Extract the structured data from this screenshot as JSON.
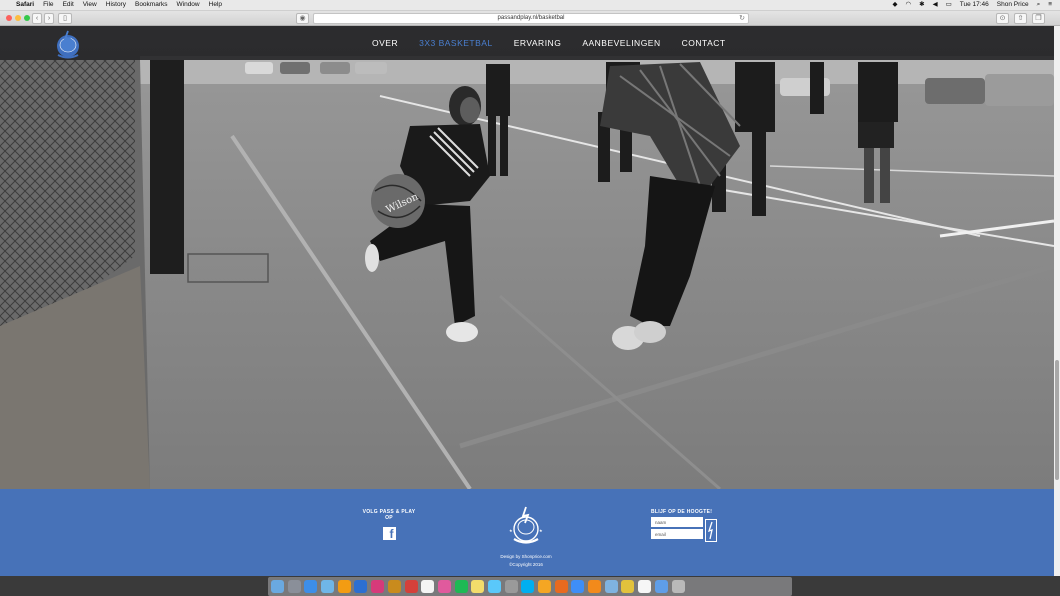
{
  "menubar": {
    "app": "Safari",
    "items": [
      "File",
      "Edit",
      "View",
      "History",
      "Bookmarks",
      "Window",
      "Help"
    ],
    "clock": "Tue 17:46",
    "user": "Shon Price"
  },
  "browser": {
    "url": "passandplay.nl/basketbal"
  },
  "nav": {
    "links": [
      {
        "label": "OVER",
        "active": false
      },
      {
        "label": "3X3 BASKETBAL",
        "active": true
      },
      {
        "label": "ERVARING",
        "active": false
      },
      {
        "label": "AANBEVELINGEN",
        "active": false
      },
      {
        "label": "CONTACT",
        "active": false
      }
    ],
    "accent": "#4a7fd0"
  },
  "footer": {
    "follow_title": "VOLG PASS & PLAY OP",
    "facebook_icon": "facebook-icon",
    "credit_line1": "Design by Shonprice.com",
    "credit_line2": "©Copyright 2016",
    "newsletter_title": "BLIJF OP DE HOOGTE!",
    "name_placeholder": "naam",
    "email_placeholder": "email",
    "background": "#4772b8"
  },
  "dock": {
    "icons": [
      "finder-icon",
      "launchpad-icon",
      "safari-icon",
      "mail-icon",
      "illustrator-icon",
      "photoshop-icon",
      "indesign-icon",
      "bridge-icon",
      "acrobat-icon",
      "calendar-icon",
      "itunes-icon",
      "spotify-icon",
      "notes-icon",
      "messages-icon",
      "preferences-icon",
      "skype-icon",
      "photos-icon",
      "firefox-icon",
      "appstore-icon",
      "vlc-icon",
      "preview-icon",
      "chrome-icon",
      "textedit-icon",
      "downloads-icon",
      "trash-icon"
    ]
  }
}
